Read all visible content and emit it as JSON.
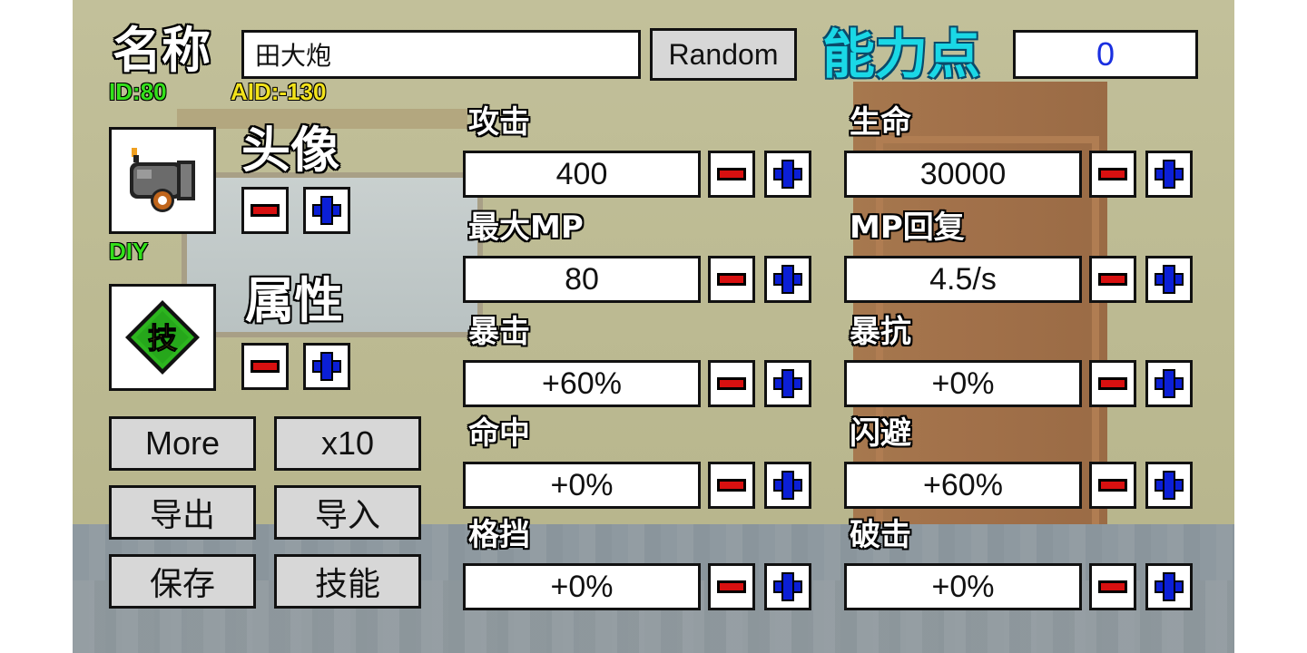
{
  "header": {
    "name_label": "名称",
    "name_value": "田大炮",
    "random_button": "Random",
    "points_label": "能力点",
    "points_value": "0",
    "id_text": "ID:80",
    "aid_text": "AID:-130"
  },
  "avatar": {
    "label": "头像",
    "tag": "DIY",
    "icon": "cannon-icon"
  },
  "attribute": {
    "label": "属性",
    "badge_text": "技",
    "icon": "skill-diamond-icon"
  },
  "buttons": {
    "more": "More",
    "x10": "x10",
    "export": "导出",
    "import": "导入",
    "save": "保存",
    "skill": "技能"
  },
  "stats": [
    {
      "id": "attack",
      "label": "攻击",
      "value": "400"
    },
    {
      "id": "hp",
      "label": "生命",
      "value": "30000"
    },
    {
      "id": "max-mp",
      "label": "最大MP",
      "value": "80"
    },
    {
      "id": "mp-regen",
      "label": "MP回复",
      "value": "4.5/s"
    },
    {
      "id": "crit",
      "label": "暴击",
      "value": "+60%"
    },
    {
      "id": "crit-resist",
      "label": "暴抗",
      "value": "+0%"
    },
    {
      "id": "hit",
      "label": "命中",
      "value": "+0%"
    },
    {
      "id": "dodge",
      "label": "闪避",
      "value": "+60%"
    },
    {
      "id": "block",
      "label": "格挡",
      "value": "+0%"
    },
    {
      "id": "break",
      "label": "破击",
      "value": "+0%"
    }
  ],
  "colors": {
    "minus": "#d81010",
    "plus": "#0b1fd6",
    "points_label": "#1ad8e6",
    "points_value": "#1a2fe0",
    "id_tag": "#33e01a",
    "aid_tag": "#f2e21a"
  }
}
